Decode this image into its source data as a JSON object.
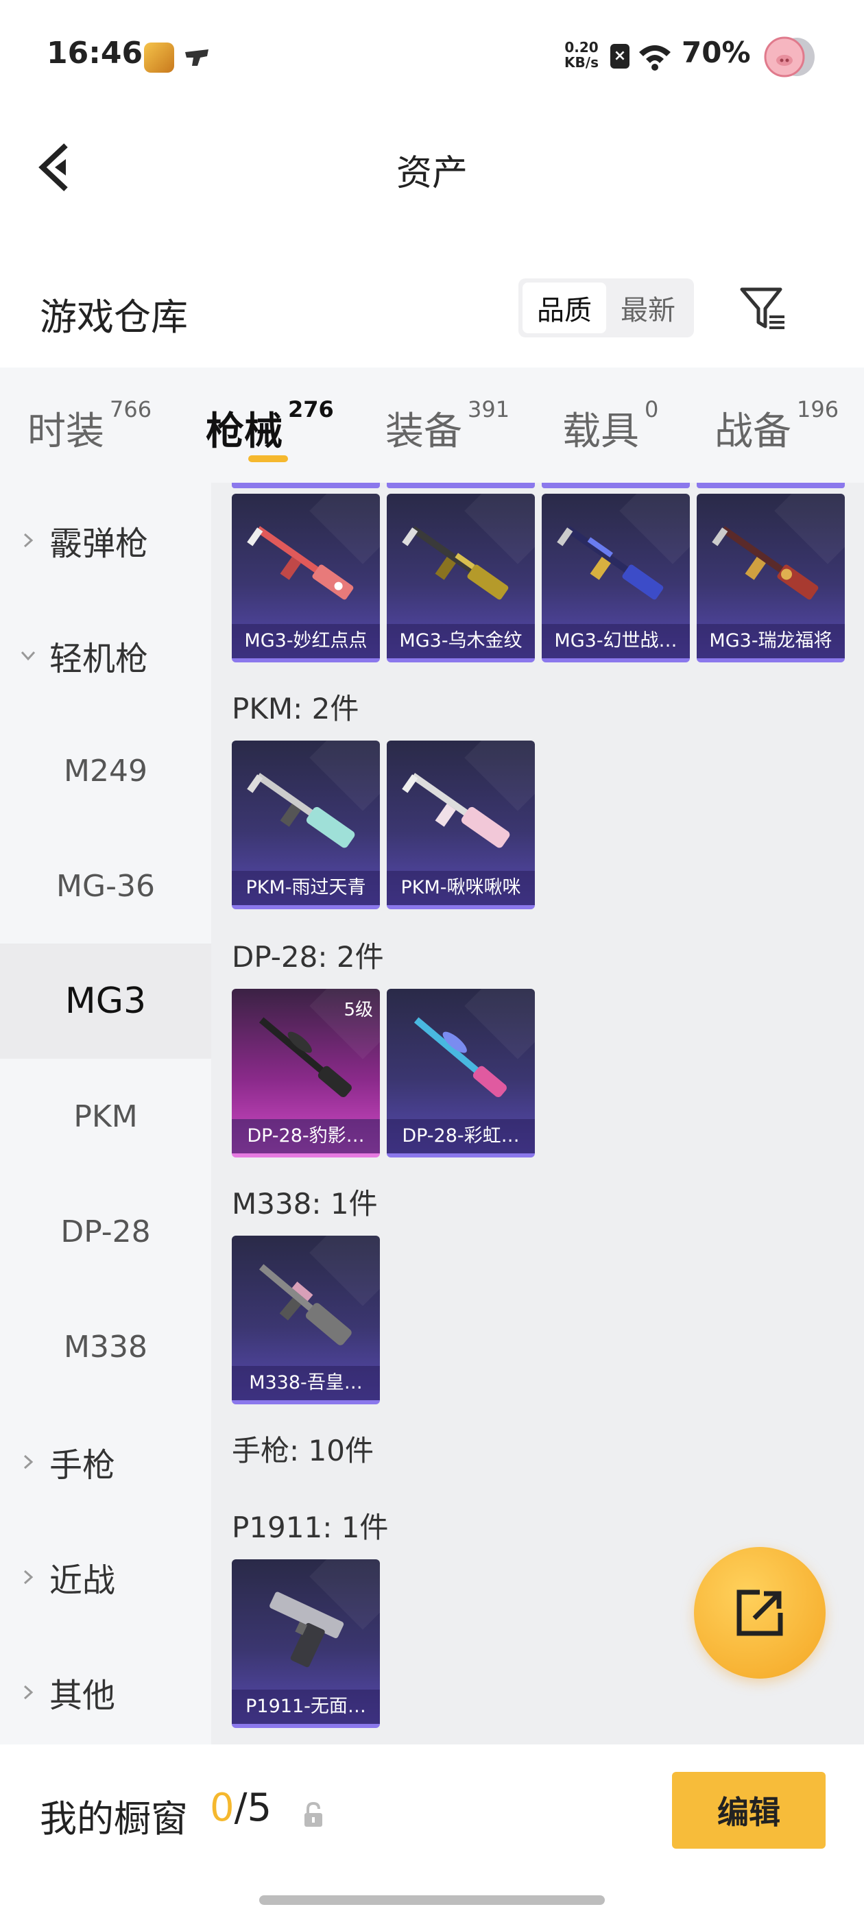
{
  "status_bar": {
    "time": "16:46",
    "net_speed_value": "0.20",
    "net_speed_unit": "KB/s",
    "battery": "70%"
  },
  "header": {
    "title": "资产"
  },
  "warehouse": {
    "title": "游戏仓库",
    "sort_options": [
      "品质",
      "最新"
    ],
    "sort_selected": "品质"
  },
  "tabs": [
    {
      "label": "时装",
      "count": "766",
      "active": false
    },
    {
      "label": "枪械",
      "count": "276",
      "active": true
    },
    {
      "label": "装备",
      "count": "391",
      "active": false
    },
    {
      "label": "载具",
      "count": "0",
      "active": false
    },
    {
      "label": "战备",
      "count": "196",
      "active": false
    }
  ],
  "sidebar": [
    {
      "label": "霰弹枪",
      "type": "category",
      "expanded": false
    },
    {
      "label": "轻机枪",
      "type": "category",
      "expanded": true
    },
    {
      "label": "M249",
      "type": "sub"
    },
    {
      "label": "MG-36",
      "type": "sub"
    },
    {
      "label": "MG3",
      "type": "sub",
      "selected": true
    },
    {
      "label": "PKM",
      "type": "sub"
    },
    {
      "label": "DP-28",
      "type": "sub"
    },
    {
      "label": "M338",
      "type": "sub"
    },
    {
      "label": "手枪",
      "type": "category",
      "expanded": false
    },
    {
      "label": "近战",
      "type": "category",
      "expanded": false
    },
    {
      "label": "其他",
      "type": "category",
      "expanded": false
    }
  ],
  "content": {
    "mg3_items": [
      "MG3-妙红点点",
      "MG3-乌木金纹",
      "MG3-幻世战…",
      "MG3-瑞龙福将"
    ],
    "pkm_header": "PKM: 2件",
    "pkm_items": [
      "PKM-雨过天青",
      "PKM-啾咪啾咪"
    ],
    "dp28_header": "DP-28: 2件",
    "dp28_items": [
      "DP-28-豹影…",
      "DP-28-彩虹…"
    ],
    "dp28_level": "5级",
    "m338_header": "M338: 1件",
    "m338_items": [
      "M338-吾皇…"
    ],
    "pistol_header": "手枪: 10件",
    "p1911_header": "P1911: 1件",
    "p1911_items": [
      "P1911-无面…"
    ]
  },
  "showcase": {
    "title": "我的橱窗",
    "used": "0",
    "total": "/5",
    "edit_label": "编辑"
  },
  "colors": {
    "accent": "#f5b82e",
    "card_purple": "#3b3670",
    "card_pink": "#d24bc8"
  },
  "icons": [
    "back-arrow-icon",
    "filter-icon",
    "chevron-right-icon",
    "chevron-down-icon",
    "lock-icon",
    "share-export-icon"
  ]
}
